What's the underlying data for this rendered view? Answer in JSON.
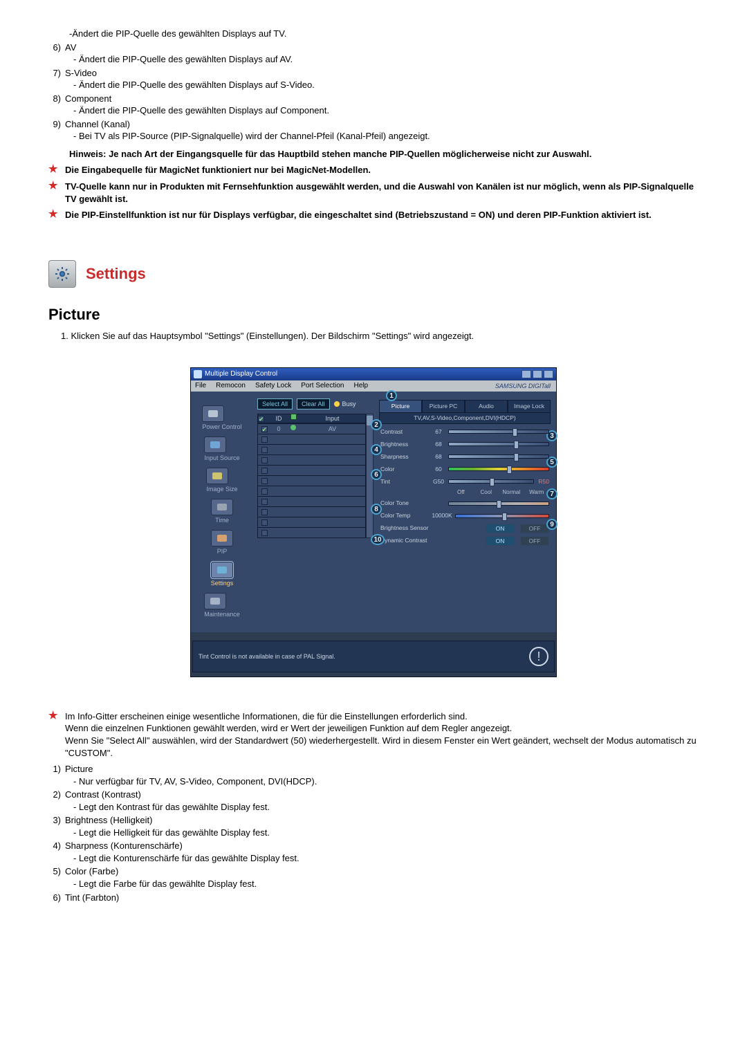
{
  "intro_indent_text": "-Ändert die PIP-Quelle des gewählten Displays auf TV.",
  "list1": [
    {
      "n": "6)",
      "title": "AV",
      "desc": "- Ändert die PIP-Quelle des gewählten Displays auf AV."
    },
    {
      "n": "7)",
      "title": "S-Video",
      "desc": "- Ändert die PIP-Quelle des gewählten Displays auf S-Video."
    },
    {
      "n": "8)",
      "title": "Component",
      "desc": "- Ändert die PIP-Quelle des gewählten Displays auf Component."
    },
    {
      "n": "9)",
      "title": "Channel (Kanal)",
      "desc": "- Bei TV als PIP-Source (PIP-Signalquelle) wird der Channel-Pfeil (Kanal-Pfeil) angezeigt."
    }
  ],
  "hinweis": "Hinweis: Je nach Art der Eingangsquelle für das Hauptbild stehen manche PIP-Quellen möglicherweise nicht zur Auswahl.",
  "stars": [
    "Die Eingabequelle für MagicNet funktioniert nur bei MagicNet-Modellen.",
    "TV-Quelle kann nur in Produkten mit Fernsehfunktion ausgewählt werden, und die Auswahl von Kanälen ist nur möglich, wenn als PIP-Signalquelle TV gewählt ist.",
    "Die PIP-Einstellfunktion ist nur für Displays verfügbar, die eingeschaltet sind (Betriebszustand = ON) und deren PIP-Funktion aktiviert ist."
  ],
  "settings_title": "Settings",
  "picture_title": "Picture",
  "picture_desc": "1.  Klicken Sie auf das Hauptsymbol \"Settings\" (Einstellungen). Der Bildschirm \"Settings\" wird angezeigt.",
  "app": {
    "title": "Multiple Display Control",
    "menus": [
      "File",
      "Remocon",
      "Safety Lock",
      "Port Selection",
      "Help"
    ],
    "brand": "SAMSUNG DIGITall",
    "side": [
      {
        "label": "Power Control"
      },
      {
        "label": "Input Source"
      },
      {
        "label": "Image Size"
      },
      {
        "label": "Time"
      },
      {
        "label": "PIP"
      },
      {
        "label": "Settings"
      },
      {
        "label": "Maintenance"
      }
    ],
    "select_all": "Select All",
    "clear_all": "Clear All",
    "busy": "Busy",
    "cols": {
      "c1": "",
      "c2": "ID",
      "c3": "",
      "c4": "Input"
    },
    "row0": {
      "id": "0",
      "input": "AV"
    },
    "tabs": [
      "Picture",
      "Picture PC",
      "Audio",
      "Image Lock"
    ],
    "subheader": "TV,AV,S-Video,Component,DVI(HDCP)",
    "sl": {
      "contrast": {
        "l": "Contrast",
        "v": "67"
      },
      "brightness": {
        "l": "Brightness",
        "v": "68"
      },
      "sharpness": {
        "l": "Sharpness",
        "v": "68"
      },
      "color": {
        "l": "Color",
        "v": "60"
      },
      "tint": {
        "l": "Tint",
        "v": "G50",
        "r": "R50"
      },
      "tone": {
        "l": "Color Tone",
        "opts": [
          "Off",
          "Cool",
          "Normal",
          "Warm"
        ]
      },
      "temp": {
        "l": "Color Temp",
        "v": "10000K"
      },
      "bs": {
        "l": "Brightness Sensor"
      },
      "dc": {
        "l": "Dynamic Contrast"
      },
      "on": "ON",
      "off": "OFF"
    },
    "tip": "Tint Control is not available in case of PAL Signal."
  },
  "info_star": "Im Info-Gitter erscheinen einige wesentliche Informationen, die für die Einstellungen erforderlich sind.\nWenn die einzelnen Funktionen gewählt werden, wird er Wert der jeweiligen Funktion auf dem Regler angezeigt.\nWenn Sie \"Select All\" auswählen, wird der Standardwert (50) wiederhergestellt. Wird in diesem Fenster ein Wert geändert, wechselt der Modus automatisch zu \"CUSTOM\".",
  "list2": [
    {
      "n": "1)",
      "title": "Picture",
      "desc": "- Nur verfügbar für TV, AV, S-Video, Component, DVI(HDCP)."
    },
    {
      "n": "2)",
      "title": "Contrast (Kontrast)",
      "desc": "- Legt den Kontrast für das gewählte Display fest."
    },
    {
      "n": "3)",
      "title": "Brightness (Helligkeit)",
      "desc": "- Legt die Helligkeit für das gewählte Display fest."
    },
    {
      "n": "4)",
      "title": "Sharpness (Konturenschärfe)",
      "desc": "- Legt die Konturenschärfe für das gewählte Display fest."
    },
    {
      "n": "5)",
      "title": "Color (Farbe)",
      "desc": "- Legt die Farbe für das gewählte Display fest."
    },
    {
      "n": "6)",
      "title": "Tint (Farbton)",
      "desc": ""
    }
  ]
}
